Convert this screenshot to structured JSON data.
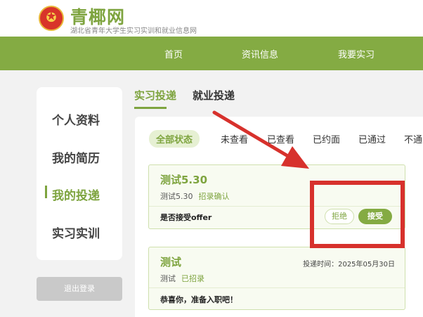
{
  "header": {
    "site_title": "青椰网",
    "site_subtitle": "湖北省青年大学生实习实训和就业信息网"
  },
  "nav": {
    "items": [
      {
        "label": "首页"
      },
      {
        "label": "资讯信息"
      },
      {
        "label": "我要实习"
      }
    ]
  },
  "sidebar": {
    "items": [
      {
        "label": "个人资料"
      },
      {
        "label": "我的简历"
      },
      {
        "label": "我的投递",
        "active": true
      },
      {
        "label": "实习实训"
      }
    ],
    "logout_label": "退出登录"
  },
  "tabs": [
    {
      "label": "实习投递",
      "active": true
    },
    {
      "label": "就业投递"
    }
  ],
  "filters": [
    {
      "label": "全部状态",
      "active": true
    },
    {
      "label": "未查看"
    },
    {
      "label": "已查看"
    },
    {
      "label": "已约面"
    },
    {
      "label": "已通过"
    },
    {
      "label": "不通"
    }
  ],
  "cards": [
    {
      "title": "测试5.30",
      "company": "测试5.30",
      "status": "招录确认",
      "note": "是否接受offer",
      "reject_label": "拒绝",
      "accept_label": "接受"
    },
    {
      "title": "测试",
      "company": "测试",
      "status": "已招录",
      "time": "投递时间：2025年05月30日",
      "note": "恭喜你，准备入职吧！"
    }
  ],
  "colors": {
    "brand_green": "#84ab43",
    "annotation_red": "#d7312c"
  }
}
